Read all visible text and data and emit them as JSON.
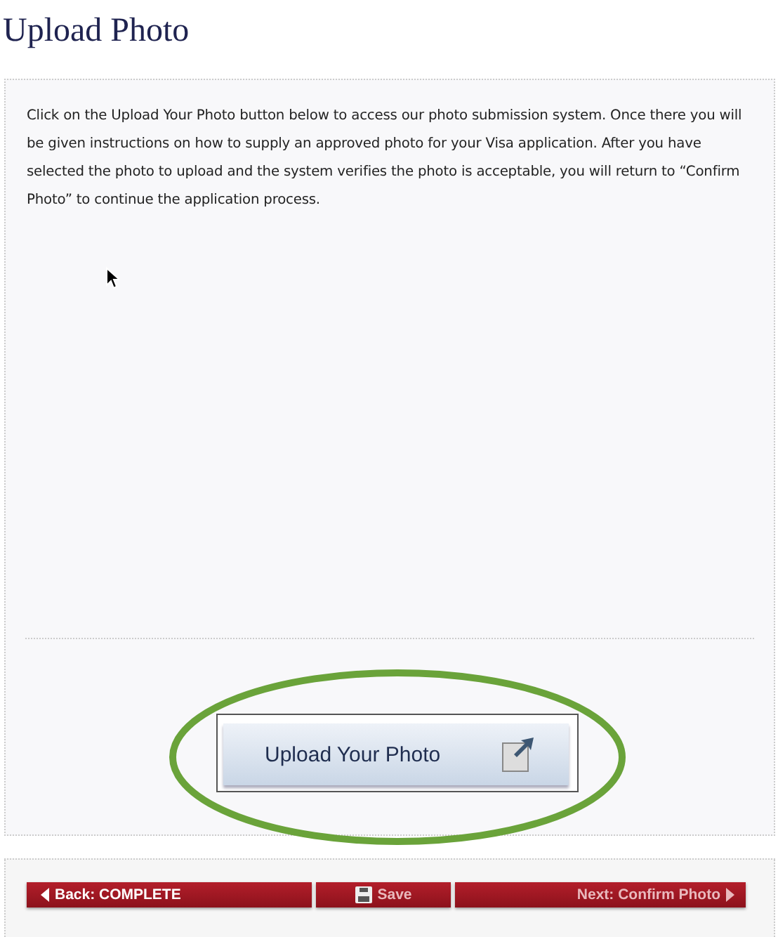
{
  "title": "Upload Photo",
  "instructions": "Click on the Upload Your Photo button below to access our photo submission system. Once there you will be given instructions on how to supply an approved photo for your Visa application. After you have selected the photo to upload and the system verifies the photo is acceptable, you will return to “Confirm Photo” to continue the application process.",
  "upload_button": {
    "label": "Upload Your Photo",
    "highlighted": true
  },
  "nav_buttons": [
    {
      "kind": "back",
      "label": "Back: COMPLETE",
      "disabled": false
    },
    {
      "kind": "save",
      "label": "Save",
      "disabled": true
    },
    {
      "kind": "next",
      "label": "Next: Confirm Photo",
      "disabled": true
    }
  ]
}
